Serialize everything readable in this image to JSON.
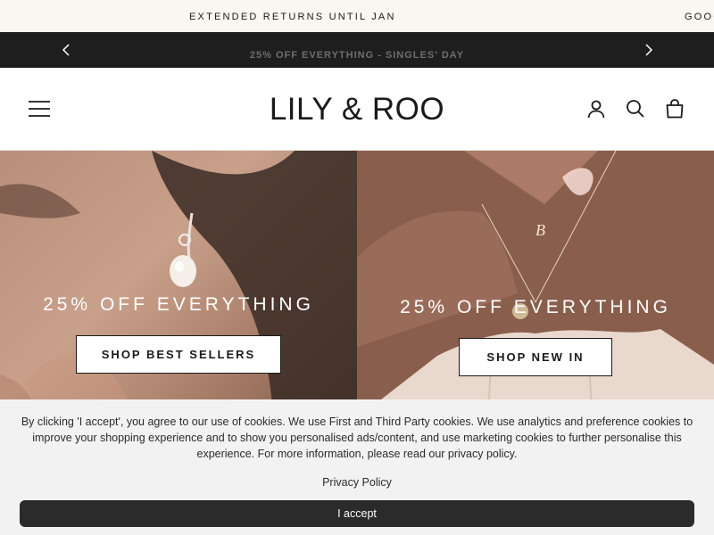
{
  "ticker": {
    "items": [
      "EXTENDED RETURNS UNTIL JAN",
      "GOOG"
    ]
  },
  "announcement": {
    "message": "25% OFF EVERYTHING - SINGLES' DAY",
    "prev_icon": "chevron-left-icon",
    "next_icon": "chevron-right-icon"
  },
  "header": {
    "logo": "LILY & ROO",
    "menu_icon": "hamburger-menu-icon",
    "account_icon": "account-icon",
    "search_icon": "search-icon",
    "bag_icon": "shopping-bag-icon"
  },
  "hero": {
    "left": {
      "headline": "25% OFF EVERYTHING",
      "cta": "SHOP BEST SELLERS"
    },
    "right": {
      "headline": "25% OFF EVERYTHING",
      "cta": "SHOP NEW IN"
    }
  },
  "cookie_banner": {
    "text": "By clicking 'I accept', you agree to our use of cookies. We use First and Third Party cookies. We use analytics and preference cookies to improve your shopping experience and to show you personalised ads/content, and use marketing cookies to further personalise this experience. For more information, please read our privacy policy.",
    "policy_link": "Privacy Policy",
    "accept_label": "I accept"
  },
  "colors": {
    "ticker_bg": "#faf6f0",
    "announcement_bg": "#1e1e1e",
    "cookie_bg": "#f2f2f2",
    "accept_bg": "#2b2b2b"
  }
}
